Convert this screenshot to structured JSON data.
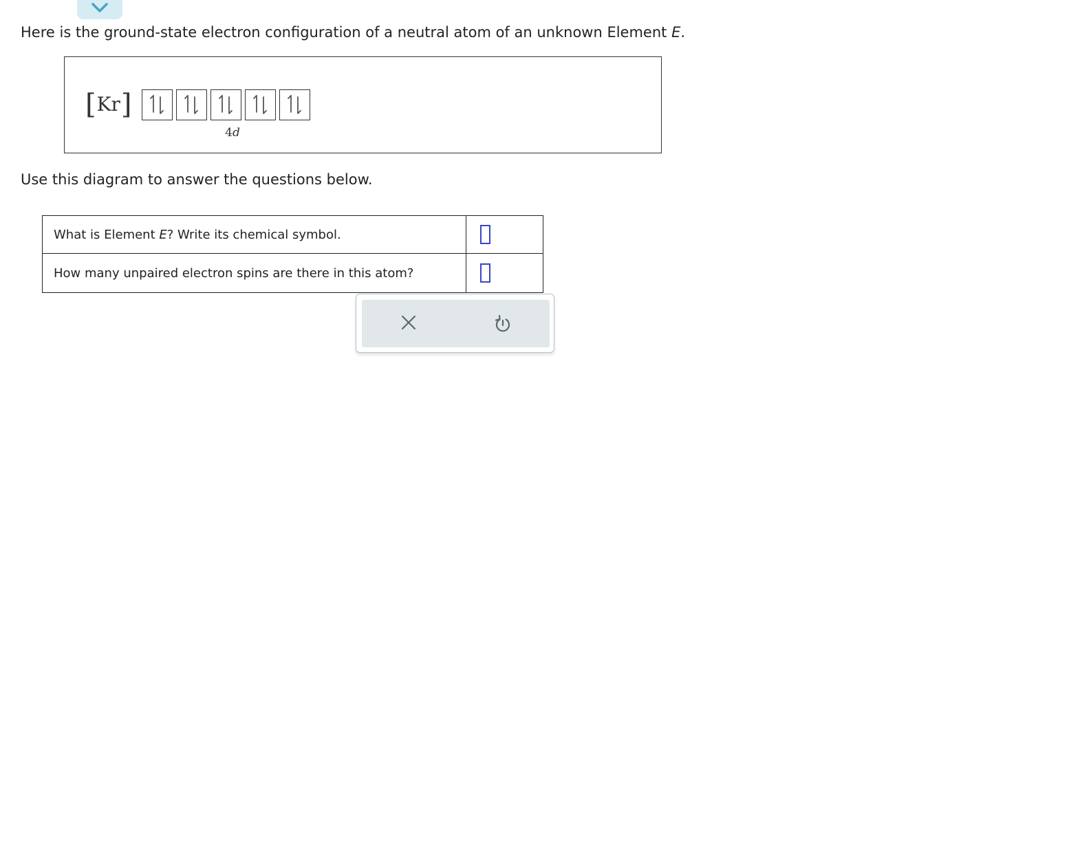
{
  "header": {
    "collapse_icon": "chevron-down-icon"
  },
  "intro": {
    "text_before": "Here is the ground-state electron configuration of a neutral atom of an unknown Element ",
    "variable": "E",
    "text_after": "."
  },
  "diagram": {
    "core_open": "[",
    "core_symbol": "Kr",
    "core_close": "]",
    "subshell_number": "4",
    "subshell_letter": "d",
    "orbitals": [
      {
        "electrons": 2,
        "icon": "paired-spin-arrows-icon"
      },
      {
        "electrons": 2,
        "icon": "paired-spin-arrows-icon"
      },
      {
        "electrons": 2,
        "icon": "paired-spin-arrows-icon"
      },
      {
        "electrons": 2,
        "icon": "paired-spin-arrows-icon"
      },
      {
        "electrons": 2,
        "icon": "paired-spin-arrows-icon"
      }
    ]
  },
  "instruction": "Use this diagram to answer the questions below.",
  "questions": [
    {
      "text_before": "What is Element ",
      "variable": "E",
      "text_after": "? Write its chemical symbol.",
      "answer_value": ""
    },
    {
      "text": "How many unpaired electron spins are there in this atom?",
      "answer_value": ""
    }
  ],
  "actions": {
    "clear_icon": "close-icon",
    "undo_icon": "undo-icon"
  },
  "colors": {
    "accent": "#3b45c8",
    "chevron": "#4ba3c3",
    "tab_bg": "#d6ecf3",
    "action_bg": "#e2e8ea",
    "icon_gray": "#5b6770"
  }
}
